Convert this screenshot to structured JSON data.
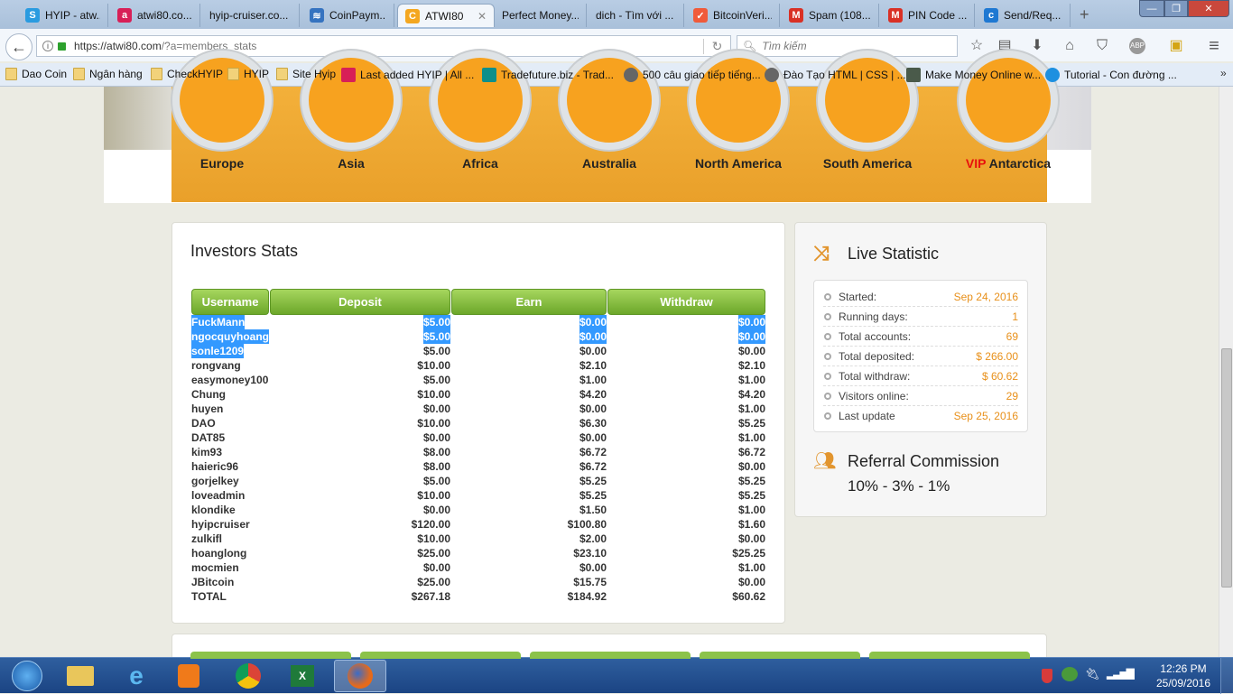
{
  "browser": {
    "tabs": [
      {
        "label": "HYIP - atw...",
        "color": "#2a9be0",
        "glyph": "S"
      },
      {
        "label": "atwi80.co...",
        "color": "#d81f57",
        "glyph": "a"
      },
      {
        "label": "hyip-cruiser.co...",
        "color": "",
        "glyph": ""
      },
      {
        "label": "CoinPaym...",
        "color": "#3573c0",
        "glyph": "≋"
      },
      {
        "label": "ATWI80",
        "color": "#f4a720",
        "glyph": "C",
        "active": true
      },
      {
        "label": "Perfect Money...",
        "color": "",
        "glyph": ""
      },
      {
        "label": "dich - Tìm với ...",
        "color": "",
        "glyph": ""
      },
      {
        "label": "BitcoinVeri...",
        "color": "#f05a3a",
        "glyph": "✓"
      },
      {
        "label": "Spam (108...",
        "color": "#d93025",
        "glyph": "M"
      },
      {
        "label": "PIN Code ...",
        "color": "#d93025",
        "glyph": "M"
      },
      {
        "label": "Send/Req...",
        "color": "#1e78d2",
        "glyph": "c"
      }
    ],
    "new_tab": "+",
    "url": "https://atwi80.com/?a=members_stats",
    "url_host": "https://atwi80.com",
    "url_path": "/?a=members_stats",
    "search_placeholder": "Tìm kiếm",
    "abp": "ABP",
    "bookmarks": [
      {
        "label": "Dao Coin",
        "icon": "folder"
      },
      {
        "label": "Ngân hàng",
        "icon": "folder"
      },
      {
        "label": "CheckHYIP",
        "icon": "folder"
      },
      {
        "label": "HYIP",
        "icon": "folder"
      },
      {
        "label": "Site Hyip",
        "icon": "folder"
      },
      {
        "label": "Last added HYIP | All ...",
        "icon": "a"
      },
      {
        "label": "Tradefuture.biz - Trad...",
        "icon": "target"
      },
      {
        "label": "500 câu giao tiếp tiếng...",
        "icon": "globe"
      },
      {
        "label": "Đào Tạo HTML | CSS | ...",
        "icon": "globe"
      },
      {
        "label": "Make Money Online w...",
        "icon": "money"
      },
      {
        "label": "Tutorial - Con đường ...",
        "icon": "dollar"
      }
    ],
    "more_bookmarks": "»"
  },
  "header": {
    "continents": [
      {
        "name": "Europe"
      },
      {
        "name": "Asia"
      },
      {
        "name": "Africa"
      },
      {
        "name": "Australia"
      },
      {
        "name": "North America"
      },
      {
        "name": "South America"
      },
      {
        "name": "Antarctica",
        "prefix": "VIP"
      }
    ],
    "accent": "#f3a72c"
  },
  "investors": {
    "title": "Investors Stats",
    "columns": [
      "Username",
      "Deposit",
      "Earn",
      "Withdraw"
    ],
    "rows": [
      [
        "FuckMann",
        "$5.00",
        "$0.00",
        "$0.00"
      ],
      [
        "ngocquyhoang",
        "$5.00",
        "$0.00",
        "$0.00"
      ],
      [
        "sonle1209",
        "$5.00",
        "$0.00",
        "$0.00"
      ],
      [
        "rongvang",
        "$10.00",
        "$2.10",
        "$2.10"
      ],
      [
        "easymoney100",
        "$5.00",
        "$1.00",
        "$1.00"
      ],
      [
        "Chung",
        "$10.00",
        "$4.20",
        "$4.20"
      ],
      [
        "huyen",
        "$0.00",
        "$0.00",
        "$1.00"
      ],
      [
        "DAO",
        "$10.00",
        "$6.30",
        "$5.25"
      ],
      [
        "DAT85",
        "$0.00",
        "$0.00",
        "$1.00"
      ],
      [
        "kim93",
        "$8.00",
        "$6.72",
        "$6.72"
      ],
      [
        "haieric96",
        "$8.00",
        "$6.72",
        "$0.00"
      ],
      [
        "gorjelkey",
        "$5.00",
        "$5.25",
        "$5.25"
      ],
      [
        "loveadmin",
        "$10.00",
        "$5.25",
        "$5.25"
      ],
      [
        "klondike",
        "$0.00",
        "$1.50",
        "$1.00"
      ],
      [
        "hyipcruiser",
        "$120.00",
        "$100.80",
        "$1.60"
      ],
      [
        "zulkifl",
        "$10.00",
        "$2.00",
        "$0.00"
      ],
      [
        "hoanglong",
        "$25.00",
        "$23.10",
        "$25.25"
      ],
      [
        "mocmien",
        "$0.00",
        "$0.00",
        "$1.00"
      ],
      [
        "JBitcoin",
        "$25.00",
        "$15.75",
        "$0.00"
      ],
      [
        "TOTAL",
        "$267.18",
        "$184.92",
        "$60.62"
      ]
    ]
  },
  "live": {
    "title": "Live Statistic",
    "stats": [
      {
        "label": "Started:",
        "value": "Sep 24, 2016"
      },
      {
        "label": "Running days:",
        "value": "1"
      },
      {
        "label": "Total accounts:",
        "value": "69"
      },
      {
        "label": "Total deposited:",
        "value": "$ 266.00"
      },
      {
        "label": "Total withdraw:",
        "value": "$ 60.62"
      },
      {
        "label": "Visitors online:",
        "value": "29"
      },
      {
        "label": "Last update",
        "value": "Sep 25, 2016"
      }
    ],
    "referral_title": "Referral Commission",
    "referral_value": "10% - 3% - 1%"
  },
  "taskbar": {
    "time": "12:26 PM",
    "date": "25/09/2016"
  }
}
